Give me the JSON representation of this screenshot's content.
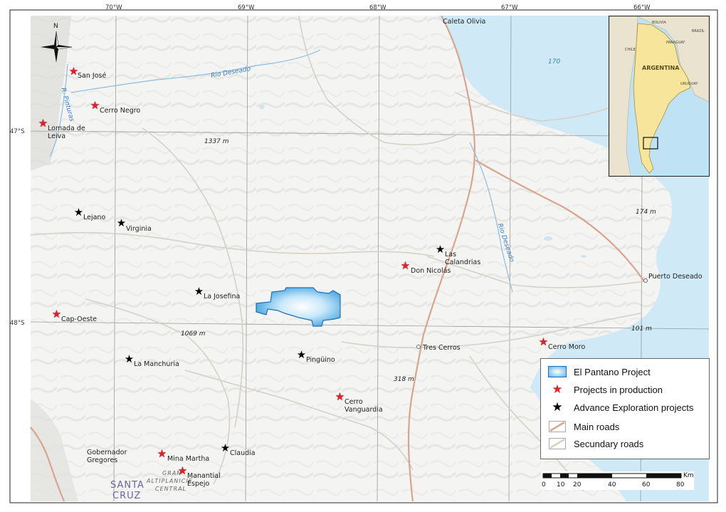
{
  "map": {
    "longitude_ticks": [
      "70°W",
      "69°W",
      "68°W",
      "67°W",
      "66°W"
    ],
    "latitude_ticks": [
      "47°S",
      "48°S"
    ],
    "places": {
      "caleta_olivia": "Caleta Olivia",
      "puerto_deseado": "Puerto Deseado",
      "tres_cerros": "Tres Cerros",
      "gobernador_gregores": "Gobernador Gregores"
    },
    "rivers": {
      "rio_deseado_north": "Rio Deseado",
      "rio_deseado_east": "Rio Deseado",
      "rio_pinturas": "R. Pinturas"
    },
    "elevations": [
      "1337 m",
      "1069 m",
      "318 m",
      "174 m",
      "101 m"
    ],
    "sea_depth": "170",
    "region": {
      "line1": "SANTA",
      "line2": "CRUZ"
    },
    "plateau": {
      "line1": "GRAN",
      "line2": "ALTIPLANICIE",
      "line3": "CENTRAL"
    },
    "north_arrow": "N",
    "production_projects": [
      "San José",
      "Cerro Negro",
      "Lomada de Leiva",
      "Cap-Oeste",
      "Don Nicolás",
      "Cerro Moro",
      "Cerro Vanguardia",
      "Mina Martha",
      "Manantial Espejo"
    ],
    "exploration_projects": [
      "Lejano",
      "Virginia",
      "La Josefina",
      "La Manchuria",
      "Pingüino",
      "Claudia",
      "Las Calandrias"
    ]
  },
  "legend": {
    "el_pantano": "El Pantano Project",
    "production": "Projects in production",
    "exploration": "Advance Exploration projects",
    "main_roads": "Main roads",
    "secondary_roads": "Secundary roads"
  },
  "inset": {
    "country": "ARGENTINA",
    "neighbors": [
      "BOLIVIA",
      "PARAGUAY",
      "BRAZIL",
      "CHILE",
      "URUGUAY"
    ]
  },
  "scale_bar": {
    "unit": "Km",
    "labels": [
      "0",
      "10",
      "20",
      "40",
      "60",
      "80"
    ]
  },
  "colors": {
    "project_fill": "#5fb6e8",
    "production_star": "#e2202a",
    "exploration_star": "#000000",
    "sea": "#bfe3f4",
    "main_road": "#d9a58e",
    "secondary_road": "#d8d6cc",
    "river": "#7ab4dc"
  }
}
